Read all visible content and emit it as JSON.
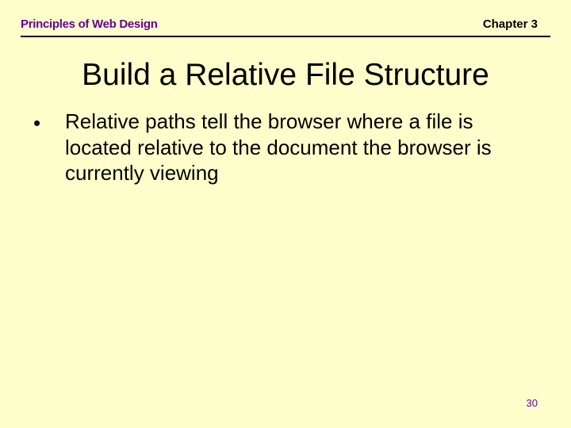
{
  "header": {
    "left": "Principles of Web Design",
    "right": "Chapter 3"
  },
  "title": "Build a Relative File Structure",
  "bullets": [
    "Relative paths tell the browser where a file is located relative to the document the browser is currently viewing"
  ],
  "page_number": "30"
}
